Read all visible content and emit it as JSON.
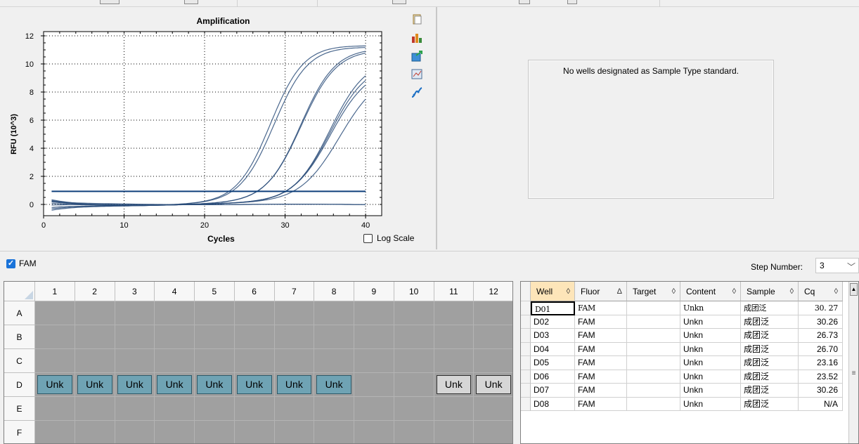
{
  "chart_data": {
    "type": "line",
    "title": "Amplification",
    "xlabel": "Cycles",
    "ylabel": "RFU (10^3)",
    "xlim": [
      0,
      42
    ],
    "ylim": [
      -0.8,
      12.3
    ],
    "xticks": [
      "0",
      "10",
      "20",
      "30",
      "40"
    ],
    "yticks": [
      "0",
      "2",
      "4",
      "6",
      "8",
      "10",
      "12"
    ],
    "grid": "dotted",
    "threshold": 0.93,
    "series": [
      {
        "cq": 23.16,
        "ymax": 11.35,
        "k": 0.48,
        "start": 0.25
      },
      {
        "cq": 23.52,
        "ymax": 11.25,
        "k": 0.47,
        "start": -0.4
      },
      {
        "cq": 26.73,
        "ymax": 11.2,
        "k": 0.46,
        "start": 0.1
      },
      {
        "cq": 26.7,
        "ymax": 11.1,
        "k": 0.45,
        "start": -0.3
      },
      {
        "cq": 30.27,
        "ymax": 10.5,
        "k": 0.44,
        "start": 0.3
      },
      {
        "cq": 30.26,
        "ymax": 10.2,
        "k": 0.43,
        "start": -0.2
      },
      {
        "cq": 30.26,
        "ymax": 9.9,
        "k": 0.42,
        "start": 0.2
      },
      {
        "cq": 31.2,
        "ymax": 9.6,
        "k": 0.4,
        "start": 0.35
      }
    ],
    "flat_series": [
      {
        "start": 0.2
      },
      {
        "start": -0.05
      }
    ],
    "line_color": "#2b4d7a",
    "threshold_color": "#0e3f7a"
  },
  "chart": {
    "log_scale_label": "Log Scale",
    "side_icons": [
      "copy-icon",
      "chart-settings-icon",
      "export-icon",
      "zoom-icon",
      "curve-fit-icon"
    ]
  },
  "std_curve": {
    "message": "No wells designated as Sample Type standard."
  },
  "fluor_bar": {
    "fam_label": "FAM",
    "step_label": "Step Number:",
    "step_value": "3"
  },
  "plate": {
    "columns": [
      "1",
      "2",
      "3",
      "4",
      "5",
      "6",
      "7",
      "8",
      "9",
      "10",
      "11",
      "12"
    ],
    "rows": [
      "A",
      "B",
      "C",
      "D",
      "E",
      "F"
    ],
    "wells": [
      {
        "row": 3,
        "col": 0,
        "label": "Unk",
        "style": "teal"
      },
      {
        "row": 3,
        "col": 1,
        "label": "Unk",
        "style": "teal"
      },
      {
        "row": 3,
        "col": 2,
        "label": "Unk",
        "style": "teal"
      },
      {
        "row": 3,
        "col": 3,
        "label": "Unk",
        "style": "teal"
      },
      {
        "row": 3,
        "col": 4,
        "label": "Unk",
        "style": "teal"
      },
      {
        "row": 3,
        "col": 5,
        "label": "Unk",
        "style": "teal"
      },
      {
        "row": 3,
        "col": 6,
        "label": "Unk",
        "style": "teal"
      },
      {
        "row": 3,
        "col": 7,
        "label": "Unk",
        "style": "teal"
      },
      {
        "row": 3,
        "col": 10,
        "label": "Unk",
        "style": "grey"
      },
      {
        "row": 3,
        "col": 11,
        "label": "Unk",
        "style": "grey"
      }
    ]
  },
  "results": {
    "columns": [
      {
        "label": "Well",
        "sort": "◊",
        "active": true
      },
      {
        "label": "Fluor",
        "sort": "Δ",
        "active": false
      },
      {
        "label": "Target",
        "sort": "◊",
        "active": false
      },
      {
        "label": "Content",
        "sort": "◊",
        "active": false
      },
      {
        "label": "Sample",
        "sort": "◊",
        "active": false
      },
      {
        "label": "Cq",
        "sort": "◊",
        "active": false
      }
    ],
    "rows": [
      [
        "D01",
        "FAM",
        "",
        "Unkn",
        "成团泛",
        "30. 27"
      ],
      [
        "D02",
        "FAM",
        "",
        "Unkn",
        "成团泛",
        "30.26"
      ],
      [
        "D03",
        "FAM",
        "",
        "Unkn",
        "成团泛",
        "26.73"
      ],
      [
        "D04",
        "FAM",
        "",
        "Unkn",
        "成团泛",
        "26.70"
      ],
      [
        "D05",
        "FAM",
        "",
        "Unkn",
        "成团泛",
        "23.16"
      ],
      [
        "D06",
        "FAM",
        "",
        "Unkn",
        "成团泛",
        "23.52"
      ],
      [
        "D07",
        "FAM",
        "",
        "Unkn",
        "成团泛",
        "30.26"
      ],
      [
        "D08",
        "FAM",
        "",
        "Unkn",
        "成团泛",
        "N/A"
      ]
    ]
  }
}
